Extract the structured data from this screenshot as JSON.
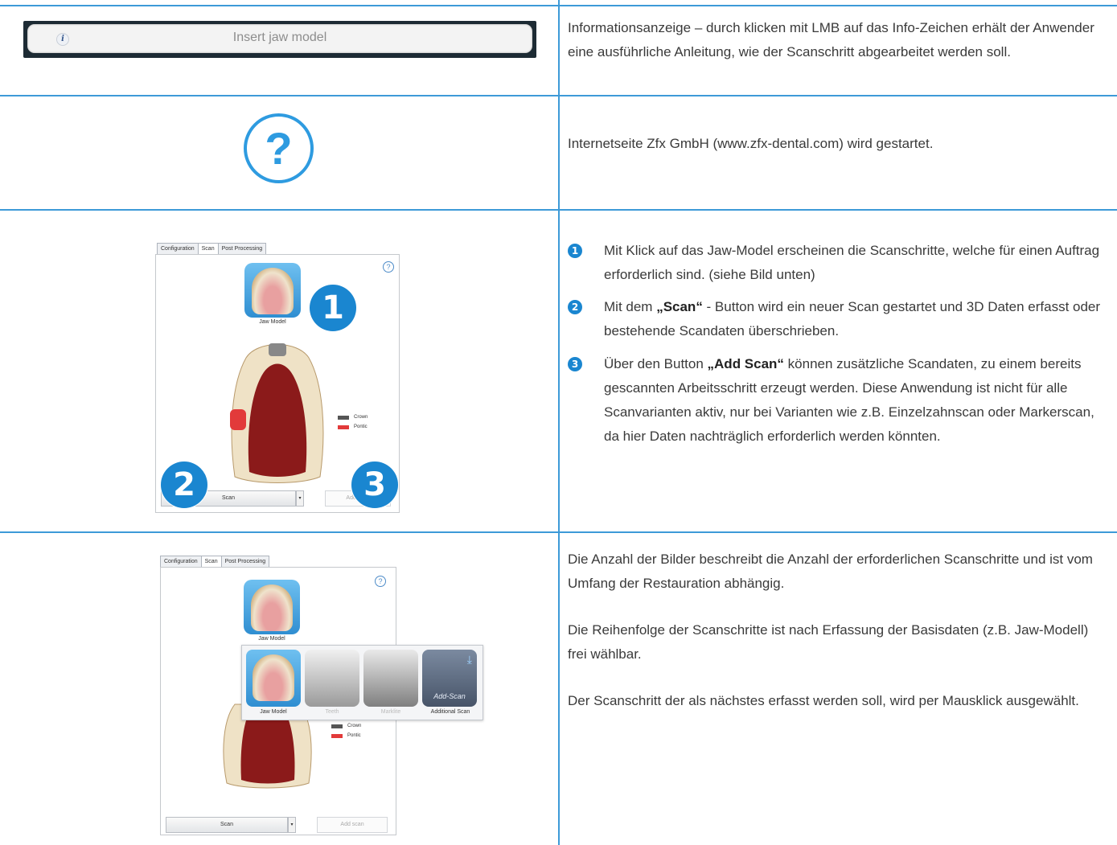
{
  "row1": {
    "infobar": {
      "label": "Insert jaw model",
      "icon": "info-icon"
    },
    "text": "Informationsanzeige – durch klicken mit LMB auf das Info-Zeichen erhält der Anwender eine ausführliche Anleitung, wie der Scanschritt abgearbeitet werden soll."
  },
  "row2": {
    "icon": "question-icon",
    "icon_glyph": "?",
    "text": "Internetseite Zfx GmbH (www.zfx-dental.com) wird gestartet."
  },
  "row3": {
    "tabs": [
      "Configuration",
      "Scan",
      "Post Processing"
    ],
    "jaw_label": "Jaw Model",
    "legend": [
      {
        "label": "Crown",
        "color": "#555555"
      },
      {
        "label": "Pontic",
        "color": "#e23a3a"
      }
    ],
    "scan_button": "Scan",
    "add_scan_button": "Add scan",
    "numbers": [
      "1",
      "2",
      "3"
    ],
    "bullets": [
      {
        "num": "1",
        "text": "Mit Klick auf das Jaw-Model erscheinen die Scanschritte, welche für einen Auftrag erforderlich sind. (siehe Bild unten)"
      },
      {
        "num": "2",
        "pre": "Mit dem ",
        "bold": "„Scan“",
        "post": " - Button wird ein neuer Scan gestartet und 3D Daten erfasst oder bestehende Scandaten überschrieben."
      },
      {
        "num": "3",
        "pre": "Über den Button ",
        "bold": "„Add Scan“",
        "post": " können zusätzliche Scandaten, zu einem bereits gescannten Arbeitsschritt erzeugt werden. Diese Anwendung ist nicht für alle Scanvarianten aktiv, nur bei Varianten wie z.B. Einzelzahnscan oder Markerscan, da hier Daten nachträglich erforderlich werden könnten."
      }
    ]
  },
  "row4": {
    "tabs": [
      "Configuration",
      "Scan",
      "Post Processing"
    ],
    "jaw_label": "Jaw Model",
    "steps": [
      "Jaw Model",
      "Teeth",
      "Marklite",
      "Additional Scan"
    ],
    "add_scan_tile_text": "Add-Scan",
    "legend": [
      {
        "label": "Crown",
        "color": "#555555"
      },
      {
        "label": "Pontic",
        "color": "#e23a3a"
      }
    ],
    "scan_button": "Scan",
    "add_scan_button": "Add scan",
    "paragraphs": [
      "Die Anzahl der Bilder beschreibt die Anzahl der erforderlichen Scanschritte und ist vom Umfang der Restauration abhängig.",
      "Die Reihenfolge der Scanschritte ist nach Erfassung der Basisdaten (z.B. Jaw-Modell) frei wählbar.",
      "Der Scanschritt der als nächstes erfasst werden soll, wird per Mausklick ausgewählt."
    ]
  },
  "colors": {
    "accent": "#3d9ad8",
    "number_badge": "#1a86d0",
    "pontic": "#e23a3a",
    "gum": "#8b1a1a"
  }
}
